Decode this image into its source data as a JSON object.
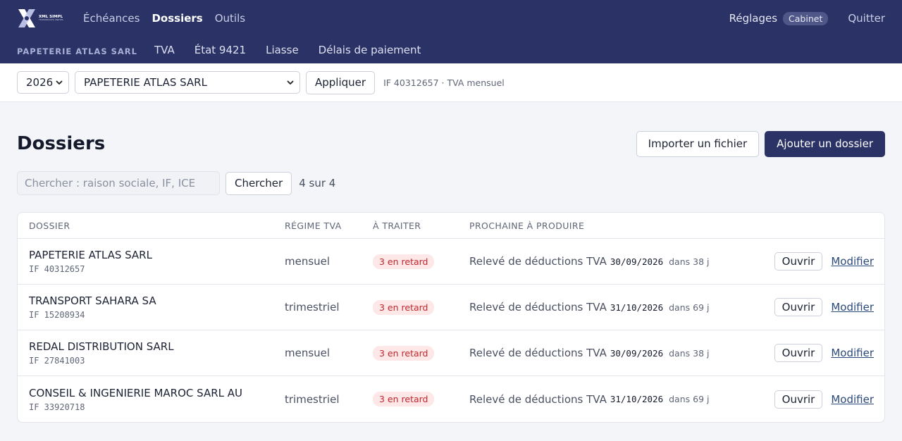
{
  "app": {
    "logo_text": "XML SIMPL",
    "logo_sub": "TELESERVICES UNIFIES"
  },
  "topnav": {
    "items": [
      "Échéances",
      "Dossiers",
      "Outils"
    ],
    "settings_label": "Réglages",
    "settings_badge": "Cabinet",
    "quit_label": "Quitter"
  },
  "company_bar": {
    "company_name": "PAPETERIE ATLAS SARL",
    "tabs": [
      "TVA",
      "État 9421",
      "Liasse",
      "Délais de paiement"
    ]
  },
  "filters": {
    "year": "2026",
    "company": "PAPETERIE ATLAS SARL",
    "apply_label": "Appliquer",
    "info": "IF 40312657 · TVA mensuel"
  },
  "page": {
    "title": "Dossiers",
    "import_label": "Importer un fichier",
    "add_label": "Ajouter un dossier",
    "search_placeholder": "Chercher : raison sociale, IF, ICE",
    "search_button": "Chercher",
    "count": "4 sur 4"
  },
  "table": {
    "headers": [
      "DOSSIER",
      "RÉGIME TVA",
      "À TRAITER",
      "PROCHAINE À PRODUIRE"
    ],
    "open_label": "Ouvrir",
    "edit_label": "Modifier",
    "rows": [
      {
        "name": "PAPETERIE ATLAS SARL",
        "if": "IF 40312657",
        "regime": "mensuel",
        "status": "3 en retard",
        "next": "Relevé de déductions TVA",
        "date": "30/09/2026",
        "delay": "dans 38 j"
      },
      {
        "name": "TRANSPORT SAHARA SA",
        "if": "IF 15208934",
        "regime": "trimestriel",
        "status": "3 en retard",
        "next": "Relevé de déductions TVA",
        "date": "31/10/2026",
        "delay": "dans 69 j"
      },
      {
        "name": "REDAL DISTRIBUTION SARL",
        "if": "IF 27841003",
        "regime": "mensuel",
        "status": "3 en retard",
        "next": "Relevé de déductions TVA",
        "date": "30/09/2026",
        "delay": "dans 38 j"
      },
      {
        "name": "CONSEIL & INGENIERIE MAROC SARL AU",
        "if": "IF 33920718",
        "regime": "trimestriel",
        "status": "3 en retard",
        "next": "Relevé de déductions TVA",
        "date": "31/10/2026",
        "delay": "dans 69 j"
      }
    ]
  },
  "colors": {
    "brand": "#2b3366",
    "late_bg": "#fde7e7",
    "late_fg": "#c0262d"
  }
}
